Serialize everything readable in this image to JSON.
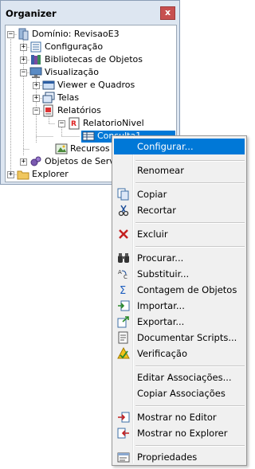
{
  "panel": {
    "title": "Organizer",
    "close_glyph": "x"
  },
  "tree": {
    "nodes": [
      {
        "label": "Domínio: RevisaoE3",
        "expander": "−",
        "icon": "domain-icon"
      },
      {
        "label": "Configuração",
        "expander": "+",
        "icon": "config-icon"
      },
      {
        "label": "Bibliotecas de Objetos",
        "expander": "+",
        "icon": "library-icon"
      },
      {
        "label": "Visualização",
        "expander": "−",
        "icon": "monitor-icon"
      },
      {
        "label": "Viewer e Quadros",
        "expander": "+",
        "icon": "viewer-icon"
      },
      {
        "label": "Telas",
        "expander": "+",
        "icon": "screens-icon"
      },
      {
        "label": "Relatórios",
        "expander": "−",
        "icon": "reports-icon"
      },
      {
        "label": "RelatorioNivel",
        "expander": "−",
        "icon": "report-icon"
      },
      {
        "label": "Consulta1",
        "expander": "",
        "icon": "query-icon",
        "selected": true
      },
      {
        "label": "Recursos",
        "expander": "",
        "icon": "resources-icon"
      },
      {
        "label": "Objetos de Servidor",
        "expander": "+",
        "icon": "server-objects-icon"
      },
      {
        "label": "Explorer",
        "expander": "+",
        "icon": "folder-icon"
      }
    ]
  },
  "menu": {
    "items": [
      {
        "label": "Configurar...",
        "icon": "",
        "highlighted": true
      },
      {
        "label": "Renomear",
        "icon": ""
      },
      {
        "label": "Copiar",
        "icon": "copy-icon"
      },
      {
        "label": "Recortar",
        "icon": "cut-icon"
      },
      {
        "label": "Excluir",
        "icon": "delete-icon"
      },
      {
        "label": "Procurar...",
        "icon": "binoculars-icon"
      },
      {
        "label": "Substituir...",
        "icon": "replace-icon"
      },
      {
        "label": "Contagem de Objetos",
        "icon": "sigma-icon"
      },
      {
        "label": "Importar...",
        "icon": "import-icon"
      },
      {
        "label": "Exportar...",
        "icon": "export-icon"
      },
      {
        "label": "Documentar Scripts...",
        "icon": "document-scripts-icon"
      },
      {
        "label": "Verificação",
        "icon": "verify-icon"
      },
      {
        "label": "Editar Associações...",
        "icon": ""
      },
      {
        "label": "Copiar Associações",
        "icon": ""
      },
      {
        "label": "Mostrar no Editor",
        "icon": "show-editor-icon"
      },
      {
        "label": "Mostrar no Explorer",
        "icon": "show-explorer-icon"
      },
      {
        "label": "Propriedades",
        "icon": "properties-icon"
      }
    ]
  }
}
